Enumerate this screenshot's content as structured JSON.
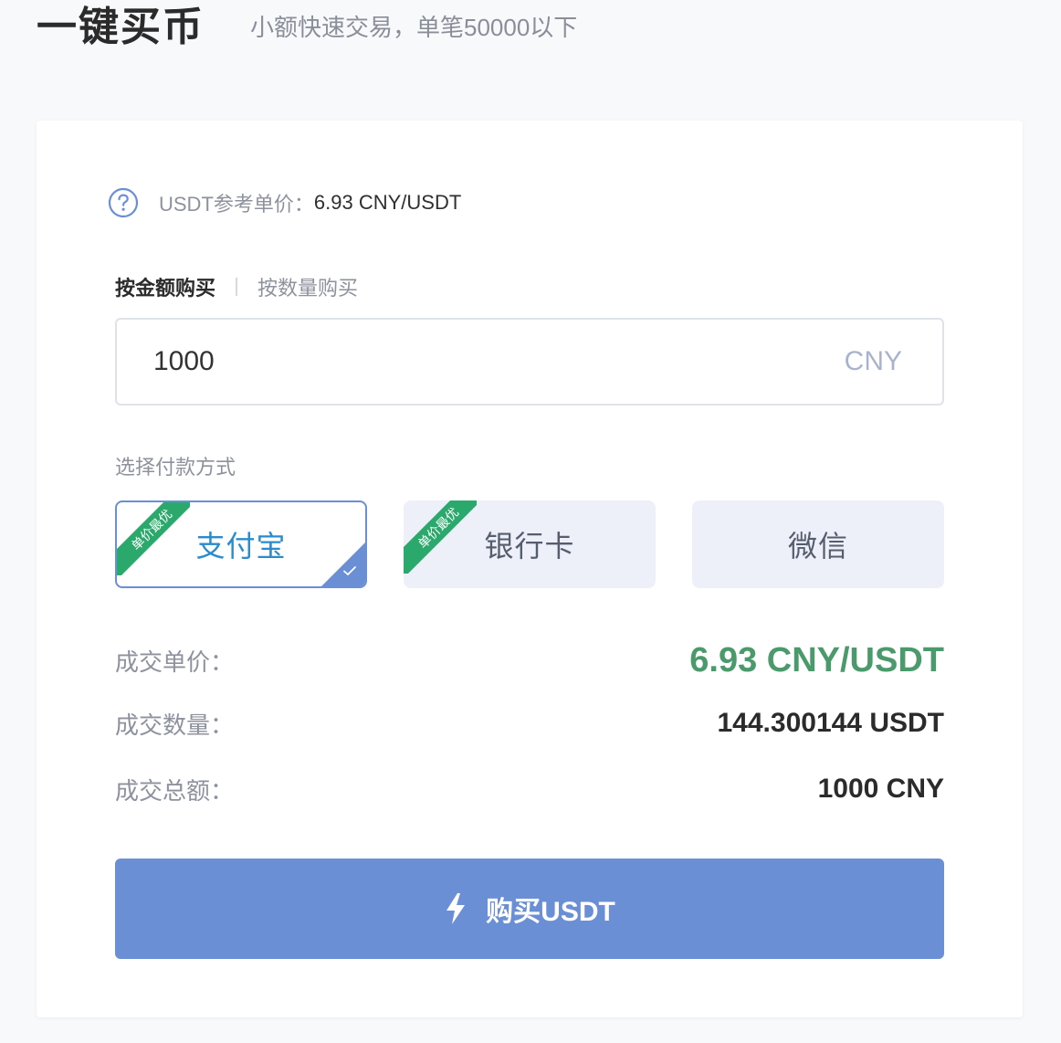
{
  "header": {
    "title": "一键买币",
    "subtitle": "小额快速交易，单笔50000以下"
  },
  "reference": {
    "icon": "question-circle-icon",
    "label": "USDT参考单价：",
    "value": "6.93 CNY/USDT"
  },
  "tabs": [
    {
      "label": "按金额购买",
      "active": true
    },
    {
      "label": "按数量购买",
      "active": false
    }
  ],
  "amount": {
    "value": "1000",
    "unit": "CNY"
  },
  "payment": {
    "label": "选择付款方式",
    "ribbon_text": "单价最优",
    "options": [
      {
        "label": "支付宝",
        "selected": true,
        "best_price": true
      },
      {
        "label": "银行卡",
        "selected": false,
        "best_price": true
      },
      {
        "label": "微信",
        "selected": false,
        "best_price": false
      }
    ]
  },
  "summary": {
    "price_label": "成交单价：",
    "price_value": "6.93 CNY/USDT",
    "qty_label": "成交数量：",
    "qty_value": "144.300144 USDT",
    "total_label": "成交总额：",
    "total_value": "1000 CNY"
  },
  "buy_button": {
    "icon": "lightning-icon",
    "label": "购买USDT"
  },
  "colors": {
    "accent": "#6a8fd4",
    "ribbon": "#2ba86b",
    "price": "#4a9a6c",
    "selected_text": "#2a8ccd"
  }
}
